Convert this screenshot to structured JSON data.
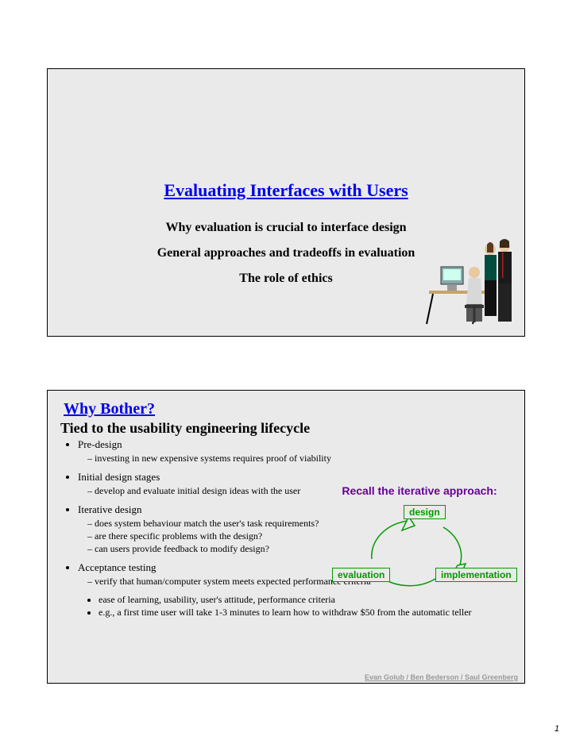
{
  "slide1": {
    "title": "Evaluating Interfaces with Users",
    "line1": "Why evaluation is crucial to interface design",
    "line2": "General approaches and tradeoffs in evaluation",
    "line3": "The role of ethics"
  },
  "slide2": {
    "title": "Why Bother?",
    "subtitle": "Tied to the usability engineering lifecycle",
    "predesign": {
      "label": "Pre-design",
      "item1": "investing in new expensive systems requires proof of viability"
    },
    "initial": {
      "label": "Initial design stages",
      "item1": "develop and evaluate initial design ideas with the user"
    },
    "iterative": {
      "label": "Iterative design",
      "item1": "does system behaviour match the user's task requirements?",
      "item2": "are there specific problems with the design?",
      "item3": "can users provide feedback to modify design?"
    },
    "acceptance": {
      "label": "Acceptance testing",
      "item1": "verify that human/computer system meets expected performance criteria",
      "item2": "ease of learning, usability, user's attitude, performance criteria",
      "item3": "e.g., a first time user will take 1-3 minutes to learn how to withdraw $50 from the automatic teller"
    },
    "diagram": {
      "caption": "Recall the iterative approach:",
      "design": "design",
      "evaluation": "evaluation",
      "implementation": "implementation"
    },
    "credit": "Evan Golub / Ben Bederson / Saul Greenberg"
  },
  "page": "1"
}
